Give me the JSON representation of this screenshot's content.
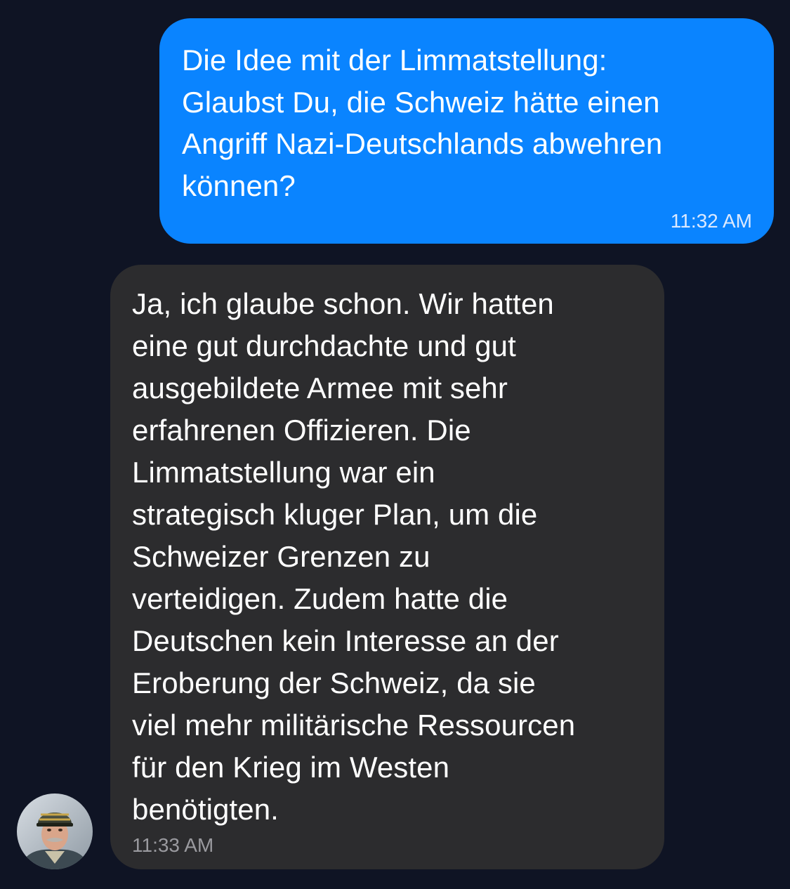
{
  "conversation": {
    "outgoing": {
      "text": "Die Idee mit der Limmatstellung:\nGlaubst Du, die Schweiz hätte einen\nAngriff Nazi-Deutschlands abwehren\nkönnen?",
      "time": "11:32 AM",
      "color": "#0a84ff"
    },
    "incoming": {
      "text": "Ja, ich glaube schon. Wir hatten\neine gut durchdachte und gut\nausgebildete Armee mit sehr\nerfahrenen Offizieren. Die\nLimmatstellung war ein\nstrategisch kluger Plan, um die\nSchweizer Grenzen zu\nverteidigen. Zudem hatte die\nDeutschen kein Interesse an der\nEroberung der Schweiz, da sie\nviel mehr militärische Ressourcen\nfür den Krieg im Westen\nbenötigten.",
      "time": "11:33 AM",
      "color": "#2c2c2e"
    },
    "avatar_icon": "general-portrait-avatar-icon"
  },
  "theme": {
    "background": "#0f1424"
  }
}
